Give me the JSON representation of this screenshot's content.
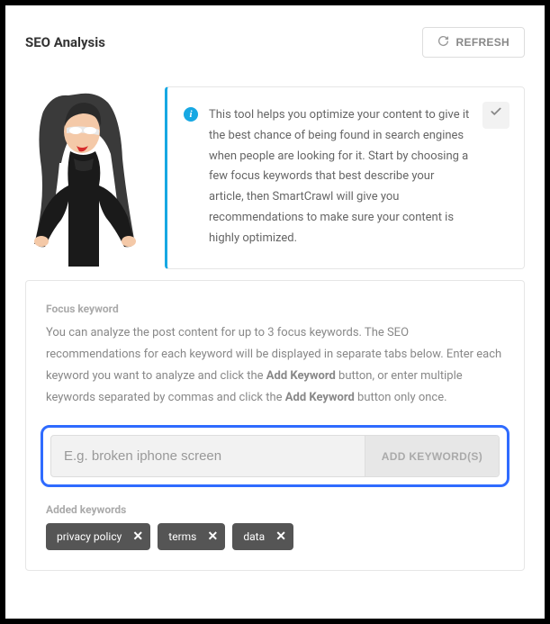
{
  "header": {
    "title": "SEO Analysis",
    "refresh_label": "REFRESH"
  },
  "info": {
    "text": "This tool helps you optimize your content to give it the best chance of being found in search engines when people are looking for it. Start by choosing a few focus keywords that best describe your article, then SmartCrawl will give you recommendations to make sure your content is highly optimized."
  },
  "focus": {
    "label": "Focus keyword",
    "desc_1": "You can analyze the post content for up to 3 focus keywords. The SEO recommendations for each keyword will be displayed in separate tabs below. Enter each keyword you want to analyze and click the ",
    "bold_1": "Add Keyword",
    "desc_2": " button, or enter multiple keywords separated by commas and click the ",
    "bold_2": "Add Keyword",
    "desc_3": " button only once.",
    "placeholder": "E.g. broken iphone screen",
    "add_label": "ADD KEYWORD(S)"
  },
  "added": {
    "label": "Added keywords",
    "tags": [
      "privacy policy",
      "terms",
      "data"
    ]
  }
}
